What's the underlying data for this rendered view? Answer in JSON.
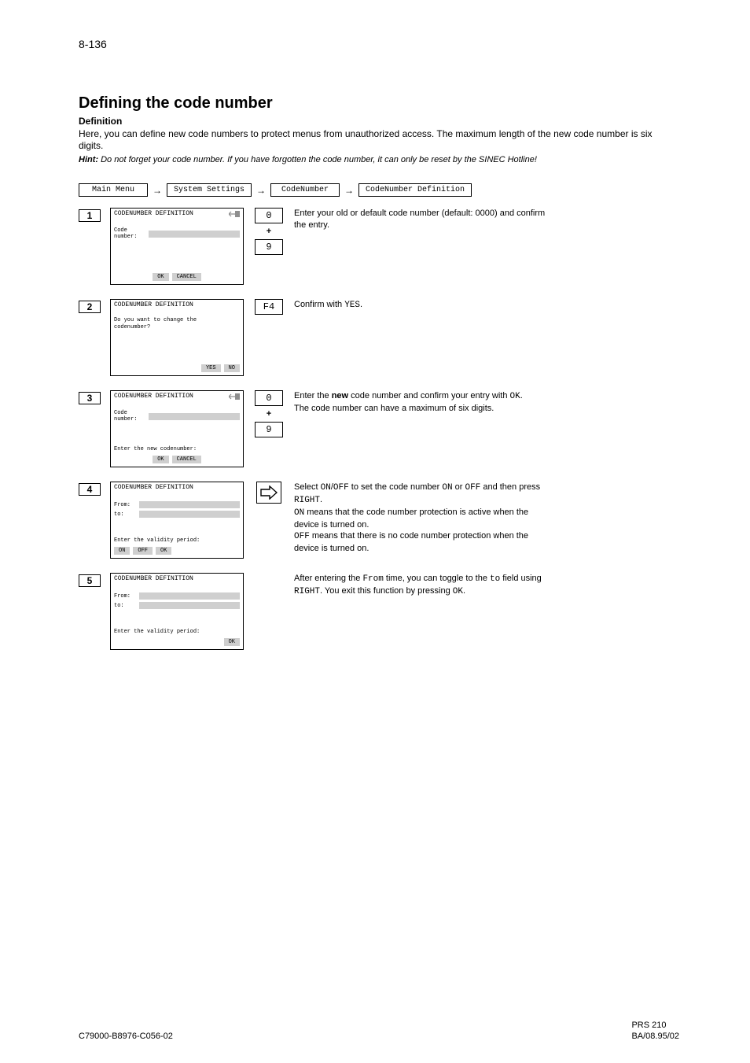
{
  "page": {
    "number": "8-136",
    "title": "Defining the code number",
    "subhead": "Definition",
    "description": "Here, you can define new code numbers to protect menus from unauthorized access. The maximum length of the new code number is six digits.",
    "hint_prefix": "Hint:",
    "hint_text": "Do not forget your code number. If you have forgotten the code number, it can only be reset by the SINEC Hotline!"
  },
  "crumbs": [
    "Main Menu",
    "System Settings",
    "CodeNumber",
    "CodeNumber Definition"
  ],
  "steps": [
    {
      "n": "1",
      "screen": {
        "title": "CODENUMBER DEFINITION",
        "has_menu_icon": true,
        "bars": [
          {
            "label": "Code number:",
            "full": true
          }
        ],
        "bottom": "",
        "buttons": [
          "OK",
          "CANCEL"
        ],
        "btn_align": "center"
      },
      "keys": [
        "0",
        "9"
      ],
      "text_lines": [
        "Enter your old or default code number (default: 0000) and confirm the entry."
      ]
    },
    {
      "n": "2",
      "screen": {
        "title": "CODENUMBER DEFINITION",
        "has_menu_icon": false,
        "bars": [],
        "body_lines": [
          "Do you want to change the",
          "codenumber?"
        ],
        "buttons": [
          "YES",
          "NO"
        ],
        "btn_align": "right"
      },
      "keys": [
        "F4"
      ],
      "text_lines": [
        "Confirm with YES."
      ]
    },
    {
      "n": "3",
      "screen": {
        "title": "CODENUMBER DEFINITION",
        "has_menu_icon": true,
        "bars": [
          {
            "label": "Code number:",
            "full": true
          }
        ],
        "bottom": "Enter the new codenumber:",
        "buttons": [
          "OK",
          "CANCEL"
        ],
        "btn_align": "center"
      },
      "keys": [
        "0",
        "9"
      ],
      "text_lines": [
        "Enter the new code number and confirm your entry with OK.",
        "The code number can have a maximum of six digits."
      ]
    },
    {
      "n": "4",
      "screen": {
        "title": "CODENUMBER DEFINITION",
        "has_menu_icon": false,
        "bars": [
          {
            "label": "From:",
            "full": true
          },
          {
            "label": "to:",
            "full": true,
            "narrow": true
          }
        ],
        "bottom": "Enter the validity period:",
        "buttons": [
          "ON",
          "OFF",
          "OK"
        ],
        "btn_align": "left"
      },
      "keys": [
        "RIGHT"
      ],
      "text_lines": [
        "Select ON/OFF to set the code number ON or OFF and then press RIGHT.",
        "ON means that the code number protection is active when the device is turned on.",
        "OFF means that there is no code number protection when the device is turned on."
      ]
    },
    {
      "n": "5",
      "screen": {
        "title": "CODENUMBER DEFINITION",
        "has_menu_icon": false,
        "bars": [
          {
            "label": "From:",
            "full": true
          },
          {
            "label": "to:",
            "full": true,
            "narrow": true
          }
        ],
        "bottom": "Enter the validity period:",
        "buttons": [
          "OK"
        ],
        "btn_align": "right"
      },
      "keys": [],
      "text_lines": [
        "After entering the From time, you can toggle to the to field using RIGHT. You exit this function by pressing OK."
      ]
    }
  ],
  "footer": {
    "left": "C79000-B8976-C056-02",
    "model": "PRS 210",
    "rev": "BA/08.95/02"
  }
}
